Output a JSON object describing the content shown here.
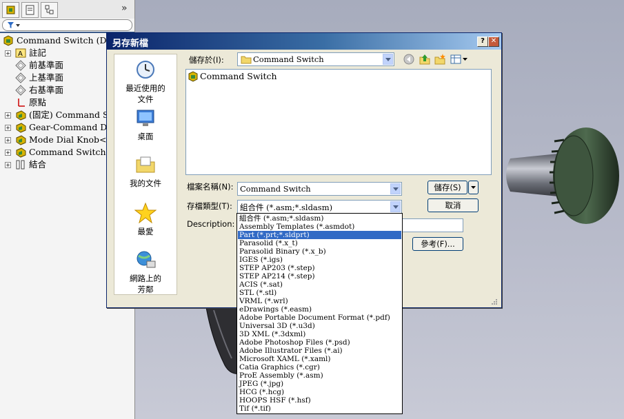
{
  "feature_manager": {
    "tree": [
      {
        "label": "Command Switch  (De",
        "icon": "assembly-icon",
        "expander": ""
      },
      {
        "label": "註記",
        "icon": "annotations-icon",
        "expander": "+"
      },
      {
        "label": "前基準面",
        "icon": "plane-icon",
        "expander": ""
      },
      {
        "label": "上基準面",
        "icon": "plane-icon",
        "expander": ""
      },
      {
        "label": "右基準面",
        "icon": "plane-icon",
        "expander": ""
      },
      {
        "label": "原點",
        "icon": "origin-icon",
        "expander": ""
      },
      {
        "label": "(固定) Command S",
        "icon": "part-icon",
        "expander": "+"
      },
      {
        "label": "Gear-Command Dia",
        "icon": "part-icon",
        "expander": "+"
      },
      {
        "label": "Mode Dial Knob<1",
        "icon": "part-icon",
        "expander": "+"
      },
      {
        "label": "Command Switch<",
        "icon": "part-icon",
        "expander": "+"
      },
      {
        "label": "結合",
        "icon": "mates-icon",
        "expander": "+"
      }
    ],
    "collapse_glyph": "»"
  },
  "dialog": {
    "title": "另存新檔",
    "help_glyph": "?",
    "close_glyph": "✕",
    "save_in_label": "儲存於(I):",
    "save_in_value": "Command Switch",
    "files": [
      "Command Switch"
    ],
    "places": [
      "最近使用的文件",
      "桌面",
      "我的文件",
      "最愛",
      "網路上的芳鄰"
    ],
    "filename_label": "檔案名稱(N):",
    "filename_value": "Command Switch",
    "filetype_label": "存檔類型(T):",
    "filetype_value": "組合件 (*.asm;*.sldasm)",
    "description_label": "Description:",
    "save_button": "儲存(S)",
    "cancel_button": "取消",
    "references_button": "參考(F)...",
    "file_types": [
      "組合件 (*.asm;*.sldasm)",
      "Assembly Templates (*.asmdot)",
      "Part (*.prt;*.sldprt)",
      "Parasolid (*.x_t)",
      "Parasolid Binary (*.x_b)",
      "IGES (*.igs)",
      "STEP AP203 (*.step)",
      "STEP AP214 (*.step)",
      "ACIS (*.sat)",
      "STL (*.stl)",
      "VRML (*.wrl)",
      "eDrawings (*.easm)",
      "Adobe Portable Document Format (*.pdf)",
      "Universal 3D (*.u3d)",
      "3D XML (*.3dxml)",
      "Adobe Photoshop Files (*.psd)",
      "Adobe Illustrator Files (*.ai)",
      "Microsoft XAML (*.xaml)",
      "Catia Graphics (*.cgr)",
      "ProE Assembly (*.asm)",
      "JPEG (*.jpg)",
      "HCG (*.hcg)",
      "HOOPS HSF (*.hsf)",
      "Tif (*.tif)"
    ],
    "file_types_highlighted": 2
  },
  "colors": {
    "title_bar": "#0a246a",
    "selection": "#316ac5",
    "dialog_face": "#ece9d8"
  }
}
